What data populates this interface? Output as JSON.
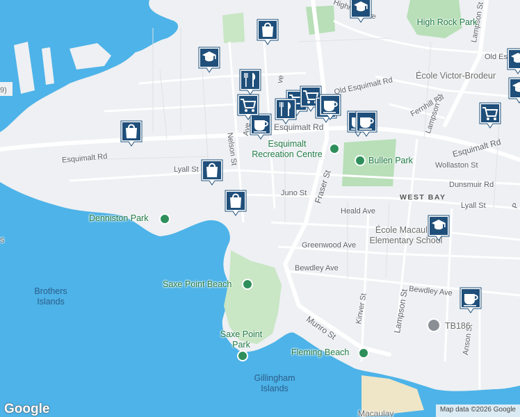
{
  "map": {
    "water_color": "#4db3e8",
    "land_color": "#eef0f3",
    "park_color": "#b8dfb8",
    "marker_color": "#1f4f7a"
  },
  "streets": {
    "highrock": "Highrock Ave",
    "lampson_north": "Lampson St",
    "old_esq_rd_ne": "Old Es",
    "old_esquimalt": "Old Esquimalt Rd",
    "esquimalt_west": "Esquimalt Rd",
    "esquimalt_center": "Esquimalt Rd",
    "esquimalt_east": "Esquimalt Rd",
    "fernhill": "Fernhill Rd",
    "lampson_mid": "Lampson St",
    "nelson": "Nelson St",
    "lyall_west": "Lyall St",
    "lyall_east": "Lyall St",
    "wollaston": "Wollaston St",
    "dunsmuir": "Dunsmuir Rd",
    "juno": "Juno St",
    "fraser": "Fraser St",
    "heald": "Heald Ave",
    "greenwood": "Greenwood Ave",
    "bewdley_west": "Bewdley Ave",
    "bewdley_east": "Bewdley Ave",
    "kinver": "Kinver St",
    "lampson_south": "Lampson St",
    "munro": "Munro St",
    "anson": "Anson St",
    "ave_partial": "ve",
    "ave_partial2": "Ave",
    "p_partial": "P",
    "num_partial": "9)"
  },
  "places": {
    "high_rock_park": "High Rock Park",
    "ecole_victor": "École Victor-Brodeur",
    "esquimalt_rec": "Esquimalt Recreation Centre",
    "bullen_park": "Bullen Park",
    "west_bay": "WEST BAY",
    "ecole_macaulay": "École Macaulay Elementary School",
    "denniston_park": "Denniston Park",
    "saxe_point_beach": "Saxe Point Beach",
    "saxe_point_park": "Saxe Point Park",
    "brothers_islands": "Brothers Islands",
    "fleming_beach": "Fleming Beach",
    "gillingham_islands": "Gillingham Islands",
    "tb186": "TB186",
    "macaulay": "Macaulay",
    "left_edge": "s"
  },
  "markers": [
    {
      "icon": "graduation-cap"
    },
    {
      "icon": "shopping-bag"
    },
    {
      "icon": "graduation-cap"
    },
    {
      "icon": "restaurant"
    },
    {
      "icon": "shopping-cart"
    },
    {
      "icon": "shopping-cart"
    },
    {
      "icon": "restaurant"
    },
    {
      "icon": "restaurant"
    },
    {
      "icon": "coffee-cup"
    },
    {
      "icon": "coffee-cup"
    },
    {
      "icon": "coffee-cup"
    },
    {
      "icon": "shopping-cart"
    },
    {
      "icon": "coffee-cup"
    },
    {
      "icon": "shopping-bag"
    },
    {
      "icon": "shopping-bag"
    },
    {
      "icon": "shopping-bag"
    },
    {
      "icon": "graduation-cap"
    },
    {
      "icon": "graduation-cap"
    },
    {
      "icon": "coffee-cup"
    },
    {
      "icon": "shopping-cart"
    },
    {
      "icon": "graduation-cap"
    }
  ],
  "attribution": {
    "logo": "Google",
    "text": "Map data ©2026 Google"
  }
}
